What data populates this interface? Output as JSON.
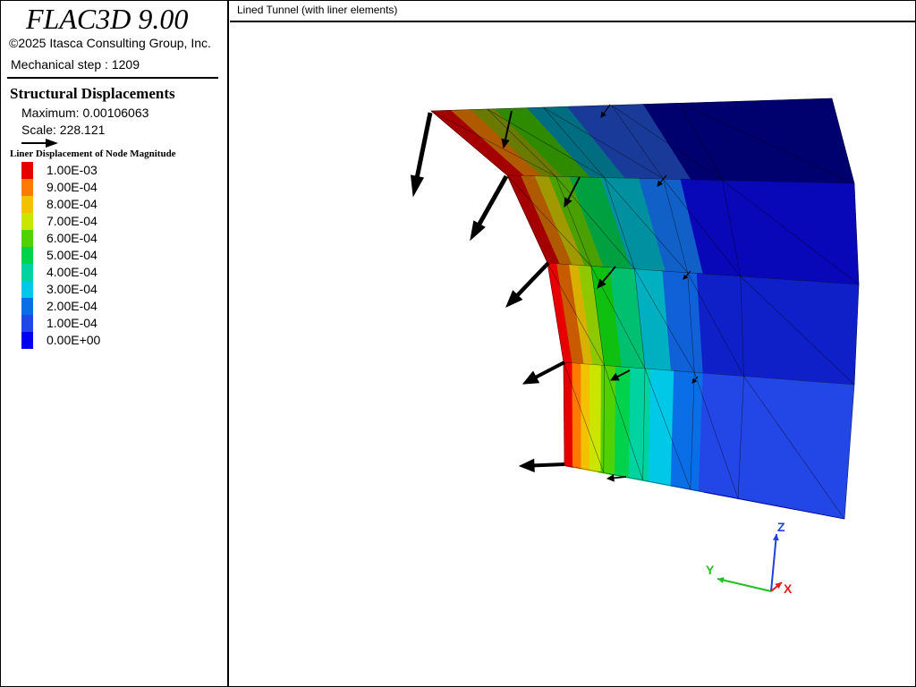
{
  "app": {
    "title": "FLAC3D 9.00",
    "copyright": "©2025 Itasca Consulting Group, Inc.",
    "step": "Mechanical step : 1209"
  },
  "view": {
    "title": "Lined Tunnel (with liner elements)"
  },
  "plot": {
    "title": "Structural Displacements",
    "maximum": "Maximum: 0.00106063",
    "scale": "Scale: 228.121"
  },
  "legend": {
    "title": "Liner Displacement of Node Magnitude",
    "items": [
      {
        "label": "1.00E-03",
        "color": "#e60000"
      },
      {
        "label": "9.00E-04",
        "color": "#ff7a00"
      },
      {
        "label": "8.00E-04",
        "color": "#f2c200"
      },
      {
        "label": "7.00E-04",
        "color": "#c8e600"
      },
      {
        "label": "6.00E-04",
        "color": "#50d200"
      },
      {
        "label": "5.00E-04",
        "color": "#00d24b"
      },
      {
        "label": "4.00E-04",
        "color": "#00d2a0"
      },
      {
        "label": "3.00E-04",
        "color": "#00c8e6"
      },
      {
        "label": "2.00E-04",
        "color": "#0a6ee6"
      },
      {
        "label": "1.00E-04",
        "color": "#2346e6"
      },
      {
        "label": "0.00E+00",
        "color": "#0000f0"
      }
    ]
  },
  "axes": {
    "x": {
      "label": "X",
      "color": "#e02020"
    },
    "y": {
      "label": "Y",
      "color": "#20c020"
    },
    "z": {
      "label": "Z",
      "color": "#2040e0"
    }
  },
  "palette": {
    "dark_navy": "#00006e",
    "dark_red": "#a40000",
    "dark_orange": "#b05a00",
    "olive": "#6a7a00",
    "dark_green": "#2e8a00",
    "teal": "#006e80"
  }
}
